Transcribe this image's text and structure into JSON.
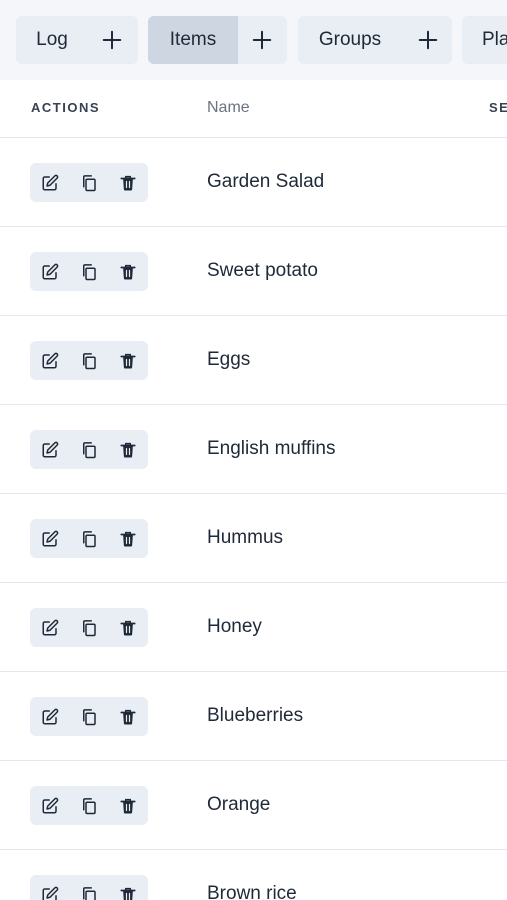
{
  "tabs": [
    {
      "label": "Log",
      "active": false
    },
    {
      "label": "Items",
      "active": true
    },
    {
      "label": "Groups",
      "active": false
    },
    {
      "label": "Pla",
      "active": false
    }
  ],
  "table": {
    "headers": {
      "actions": "ACTIONS",
      "name": "Name",
      "next": "SE"
    },
    "rows": [
      {
        "name": "Garden Salad"
      },
      {
        "name": "Sweet potato"
      },
      {
        "name": "Eggs"
      },
      {
        "name": "English muffins"
      },
      {
        "name": "Hummus"
      },
      {
        "name": "Honey"
      },
      {
        "name": "Blueberries"
      },
      {
        "name": "Orange"
      },
      {
        "name": "Brown rice"
      }
    ]
  },
  "icons": {
    "add": "plus-icon",
    "edit": "edit-icon",
    "copy": "copy-icon",
    "delete": "trash-icon"
  },
  "colors": {
    "tab_bg": "#e9eef4",
    "tab_active_bg": "#cdd6e1",
    "text": "#1f2937",
    "muted_text": "#6b7280"
  }
}
